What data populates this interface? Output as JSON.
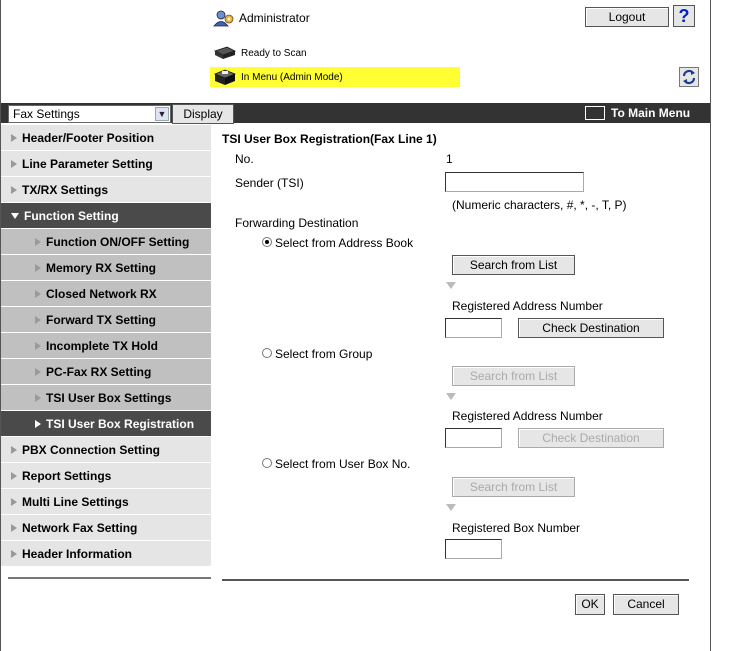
{
  "header": {
    "user": "Administrator",
    "logout_label": "Logout",
    "help_label": "?",
    "status_scan": "Ready to Scan",
    "status_menu": "In Menu (Admin Mode)"
  },
  "toolbar": {
    "select_value": "Fax Settings",
    "display_label": "Display",
    "main_menu_label": "To Main Menu"
  },
  "sidebar": {
    "items": [
      {
        "label": "Header/Footer Position"
      },
      {
        "label": "Line Parameter Setting"
      },
      {
        "label": "TX/RX Settings"
      },
      {
        "label": "Function Setting"
      },
      {
        "label": "Function ON/OFF Setting"
      },
      {
        "label": "Memory RX Setting"
      },
      {
        "label": "Closed Network RX"
      },
      {
        "label": "Forward TX Setting"
      },
      {
        "label": "Incomplete TX Hold"
      },
      {
        "label": "PC-Fax RX Setting"
      },
      {
        "label": "TSI User Box Settings"
      },
      {
        "label": "TSI User Box Registration"
      },
      {
        "label": "PBX Connection Setting"
      },
      {
        "label": "Report Settings"
      },
      {
        "label": "Multi Line Settings"
      },
      {
        "label": "Network Fax Setting"
      },
      {
        "label": "Header Information"
      }
    ]
  },
  "main": {
    "title": "TSI User Box Registration(Fax Line 1)",
    "no_label": "No.",
    "no_value": "1",
    "sender_label": "Sender (TSI)",
    "sender_value": "",
    "sender_hint": "(Numeric characters, #, *, -, T, P)",
    "forwarding_label": "Forwarding Destination",
    "opt_address_book": "Select from Address Book",
    "opt_group": "Select from Group",
    "opt_user_box": "Select from User Box No.",
    "search_label": "Search from List",
    "reg_address_label": "Registered Address Number",
    "check_dest_label": "Check Destination",
    "reg_box_label": "Registered Box Number",
    "ok_label": "OK",
    "cancel_label": "Cancel"
  }
}
